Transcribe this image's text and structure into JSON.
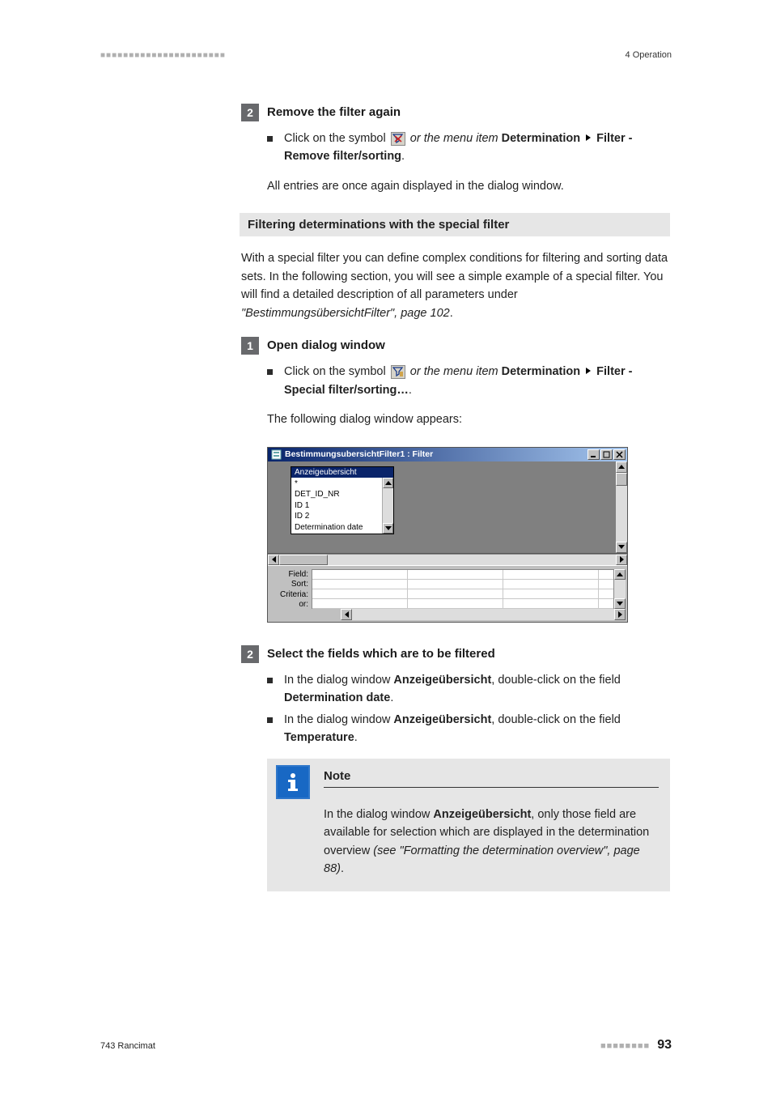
{
  "header": {
    "left_decor": "■■■■■■■■■■■■■■■■■■■■■■",
    "right": "4 Operation"
  },
  "step2a": {
    "num": "2",
    "title": "Remove the filter again",
    "bullet_pre": "Click on the symbol ",
    "bullet_mid": " or the menu item ",
    "menu1": "Determination",
    "menu2": "Filter",
    "menu3": "Remove filter/sorting",
    "result": "All entries are once again displayed in the dialog window."
  },
  "section_bar": "Filtering determinations with the special filter",
  "intro": {
    "line": "With a special filter you can define complex conditions for filtering and sorting data sets. In the following section, you will see a simple example of a special filter. You will find a detailed description of all parameters under ",
    "ref": "\"BestimmungsübersichtFilter\", page 102",
    "dot": "."
  },
  "step1b": {
    "num": "1",
    "title": "Open dialog window",
    "bullet_pre": "Click on the symbol ",
    "bullet_mid": " or the menu item ",
    "menu1": "Determination",
    "menu2": "Filter",
    "menu3": "Special filter/sorting…",
    "result": "The following dialog window appears:"
  },
  "dialog": {
    "title": "BestimmungsubersichtFilter1 : Filter",
    "anzeige_head": "Anzeigeubersicht",
    "list": [
      "*",
      "DET_ID_NR",
      "ID 1",
      "ID 2",
      "Determination date"
    ],
    "rows": [
      "Field:",
      "Sort:",
      "Criteria:",
      "or:"
    ]
  },
  "step2b": {
    "num": "2",
    "title": "Select the fields which are to be filtered",
    "b1_pre": "In the dialog window ",
    "b1_bold1": "Anzeigeübersicht",
    "b1_mid": ", double-click on the field ",
    "b1_bold2": "Determination date",
    "b2_pre": "In the dialog window ",
    "b2_bold1": "Anzeigeübersicht",
    "b2_mid": ", double-click on the field ",
    "b2_bold2": "Temperature"
  },
  "note": {
    "heading": "Note",
    "pre": "In the dialog window ",
    "bold": "Anzeigeübersicht",
    "mid": ", only those field are available for selection which are displayed in the determination overview ",
    "ref": "(see \"Formatting the determination overview\", page 88)",
    "dot": "."
  },
  "footer": {
    "left": "743 Rancimat",
    "right_decor": "■■■■■■■■",
    "page": "93"
  }
}
